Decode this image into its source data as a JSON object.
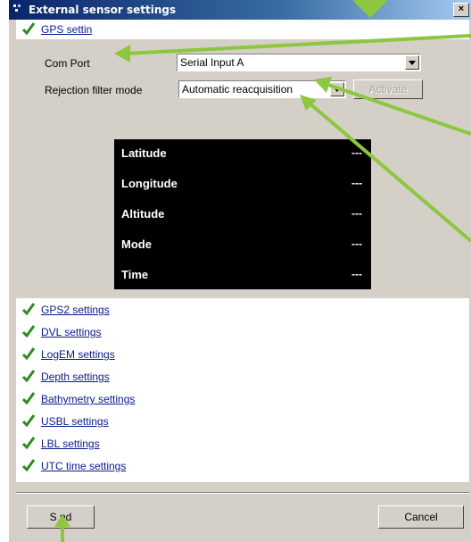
{
  "window": {
    "title": "External sensor settings",
    "close_label": "×"
  },
  "gps": {
    "section_label": "GPS settin",
    "com_port_label": "Com Port",
    "com_port_value": "Serial Input A",
    "rejection_label": "Rejection filter mode",
    "rejection_value": "Automatic reacquisition",
    "activate_label": "Activate",
    "readout": [
      {
        "key": "Latitude",
        "value": "---"
      },
      {
        "key": "Longitude",
        "value": "---"
      },
      {
        "key": "Altitude",
        "value": "---"
      },
      {
        "key": "Mode",
        "value": "---"
      },
      {
        "key": "Time",
        "value": "---"
      }
    ]
  },
  "sections": [
    "GPS2 settings",
    "DVL settings",
    "LogEM settings",
    "Depth settings",
    "Bathymetry settings",
    "USBL settings",
    "LBL settings",
    "UTC time settings"
  ],
  "footer": {
    "send_label": "S nd",
    "cancel_label": "Cancel"
  },
  "colors": {
    "annotation_arrow": "#8dc63f",
    "check": "#2e8b1e",
    "link": "#0a1a8a"
  }
}
